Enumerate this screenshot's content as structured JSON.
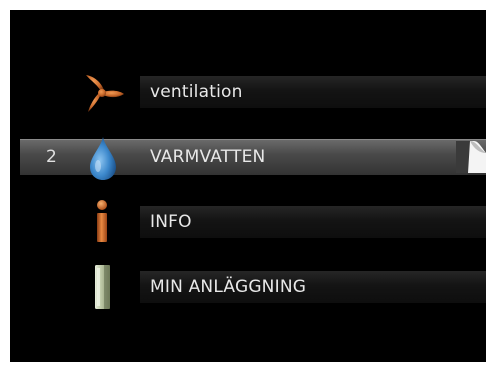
{
  "menu": {
    "items": [
      {
        "label": "ventilation",
        "icon": "fan-icon",
        "selected": false,
        "number": ""
      },
      {
        "label": "VARMVATTEN",
        "icon": "water-drop-icon",
        "selected": true,
        "number": "2"
      },
      {
        "label": "INFO",
        "icon": "info-icon",
        "selected": false,
        "number": ""
      },
      {
        "label": "MIN ANLÄGGNING",
        "icon": "installation-icon",
        "selected": false,
        "number": ""
      }
    ]
  },
  "colors": {
    "background": "#000000",
    "text": "#e8e8e8",
    "fan": "#c8682a",
    "drop": "#3c88cc",
    "info": "#d0702c",
    "installation": "#bcc7a6"
  }
}
